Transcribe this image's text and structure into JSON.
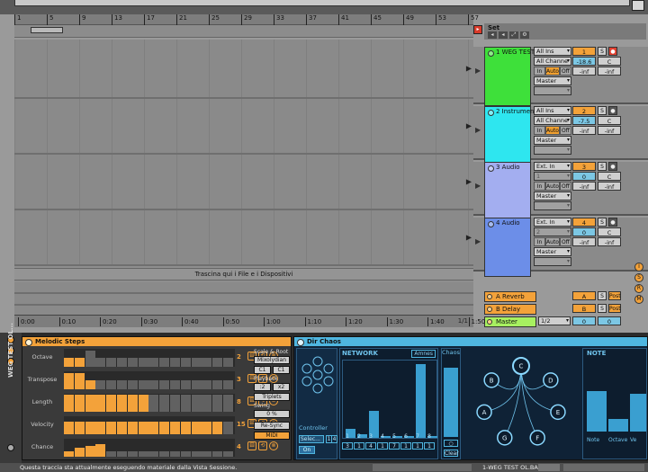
{
  "ruler": {
    "bars": [
      "1",
      "5",
      "9",
      "13",
      "17",
      "21",
      "25",
      "29",
      "33",
      "37",
      "41",
      "45",
      "49",
      "53",
      "57"
    ]
  },
  "set": {
    "label": "Set"
  },
  "arrangement": {
    "drop_label": "Trascina qui i File e i Dispositivi",
    "page": "1/1"
  },
  "tracks": [
    {
      "name": "1 WEG TEST",
      "color": "#3ee03a",
      "input": "All Ins",
      "channel": "All Channe",
      "monitor": [
        "In",
        "Auto",
        "Off"
      ],
      "output": "Master",
      "number": "1",
      "volume": "-18.6",
      "pan": "C",
      "peak_l": "-inf",
      "peak_r": "-inf",
      "arm": true
    },
    {
      "name": "2 Instrumen",
      "color": "#2ee6ef",
      "input": "All Ins",
      "channel": "All Channe",
      "monitor": [
        "In",
        "Auto",
        "Off"
      ],
      "output": "Master",
      "number": "2",
      "volume": "-7.5",
      "pan": "C",
      "peak_l": "-inf",
      "peak_r": "-inf",
      "arm": false
    },
    {
      "name": "3 Audio",
      "color": "#a3aef0",
      "input": "Ext. In",
      "channel": "1",
      "monitor": [
        "In",
        "Auto",
        "Off"
      ],
      "output": "Master",
      "number": "3",
      "volume": "0",
      "pan": "C",
      "peak_l": "-inf",
      "peak_r": "-inf",
      "arm": false
    },
    {
      "name": "4 Audio",
      "color": "#6c8ee8",
      "input": "Ext. In",
      "channel": "2",
      "monitor": [
        "In",
        "Auto",
        "Off"
      ],
      "output": "Master",
      "number": "4",
      "volume": "0",
      "pan": "C",
      "peak_l": "-inf",
      "peak_r": "-inf",
      "arm": false
    }
  ],
  "returns": [
    {
      "name": "A Reverb",
      "letter": "A",
      "value": "0",
      "post": "Post"
    },
    {
      "name": "B Delay",
      "letter": "B",
      "value": "0",
      "post": "Post"
    }
  ],
  "master": {
    "name": "Master",
    "cue": "1/2",
    "value": "0",
    "value2": "0"
  },
  "time_ruler": [
    "0:00",
    "0:10",
    "0:20",
    "0:30",
    "0:40",
    "0:50",
    "1:00",
    "1:10",
    "1:20",
    "1:30",
    "1:40",
    "1:50"
  ],
  "solo_label": "S",
  "device_strip": {
    "title": "WEG TEST OL..."
  },
  "melodic_steps": {
    "title": "Melodic Steps",
    "rows": [
      {
        "label": "Octave",
        "count": "2",
        "steps": [
          0.5,
          0.5,
          0.9,
          0.5,
          0.5,
          0.5,
          0.5,
          0.5,
          0.5,
          0.5,
          0.5,
          0.5,
          0.5,
          0.5,
          0.5,
          0.5
        ],
        "active": 2
      },
      {
        "label": "Transpose",
        "count": "3",
        "steps": [
          0.9,
          0.9,
          0.5,
          0.5,
          0.5,
          0.5,
          0.5,
          0.5,
          0.5,
          0.5,
          0.5,
          0.5,
          0.5,
          0.5,
          0.5,
          0.5
        ],
        "active": 3
      },
      {
        "label": "Length",
        "count": "8",
        "steps": [
          0.95,
          0.95,
          0.95,
          0.95,
          0.95,
          0.95,
          0.95,
          0.95,
          0.95,
          0.95,
          0.95,
          0.95,
          0.95,
          0.95,
          0.95,
          0.95
        ],
        "active": 8
      },
      {
        "label": "Velocity",
        "count": "15",
        "steps": [
          0.7,
          0.7,
          0.7,
          0.7,
          0.7,
          0.7,
          0.7,
          0.7,
          0.7,
          0.7,
          0.7,
          0.7,
          0.7,
          0.7,
          0.7,
          0.7
        ],
        "active": 15
      },
      {
        "label": "Chance",
        "count": "4",
        "steps": [
          0.3,
          0.5,
          0.6,
          0.7,
          0.3,
          0.3,
          0.3,
          0.3,
          0.3,
          0.3,
          0.3,
          0.3,
          0.3,
          0.3,
          0.3,
          0.3
        ],
        "active": 4
      }
    ],
    "side": {
      "scale_label": "Scale & Root",
      "scale": "Mixolydian",
      "root_a": "C1",
      "root_b": "C1",
      "playback_label": "Playback",
      "div_a": ":2",
      "div_b": "x2",
      "triplets": "Triplets",
      "swing_label": "Swing",
      "swing": "0 %",
      "resync": "Re-Sync",
      "midi": "MIDI"
    }
  },
  "dir_chaos": {
    "title": "Dir Chaos",
    "controller_label": "Controller",
    "controller_select": "Selec...",
    "controller_n1": "1",
    "controller_n2": "4",
    "controller_btn": "On",
    "network_label": "NETWORK",
    "network_tag": "Amnes",
    "network_bars": [
      0.12,
      0.05,
      0.35,
      0.02,
      0.02,
      0.02,
      0.95,
      0.02
    ],
    "network_nums": [
      "3",
      "1",
      "4",
      "1",
      "7",
      "1",
      "1",
      "1"
    ],
    "network_axis": [
      "1",
      "2",
      "3",
      "4",
      "5",
      "6",
      "7",
      "8"
    ],
    "chaos_label": "Chaos",
    "chaos_fill": 0.9,
    "chaos_btn1": "○",
    "chaos_btn2": "Clear",
    "nodes": [
      "C",
      "D",
      "E",
      "F",
      "G",
      "A",
      "B",
      "C"
    ],
    "note_label": "NOTE",
    "note_bars": [
      0.65,
      0.2,
      0.6
    ],
    "note_caps": [
      "Note",
      "Octave",
      "Ve"
    ]
  },
  "status": {
    "message": "Questa traccia sta attualmente eseguendo materiale dalla Vista Sessione.",
    "track": "1-WEG TEST OL.BARS"
  }
}
